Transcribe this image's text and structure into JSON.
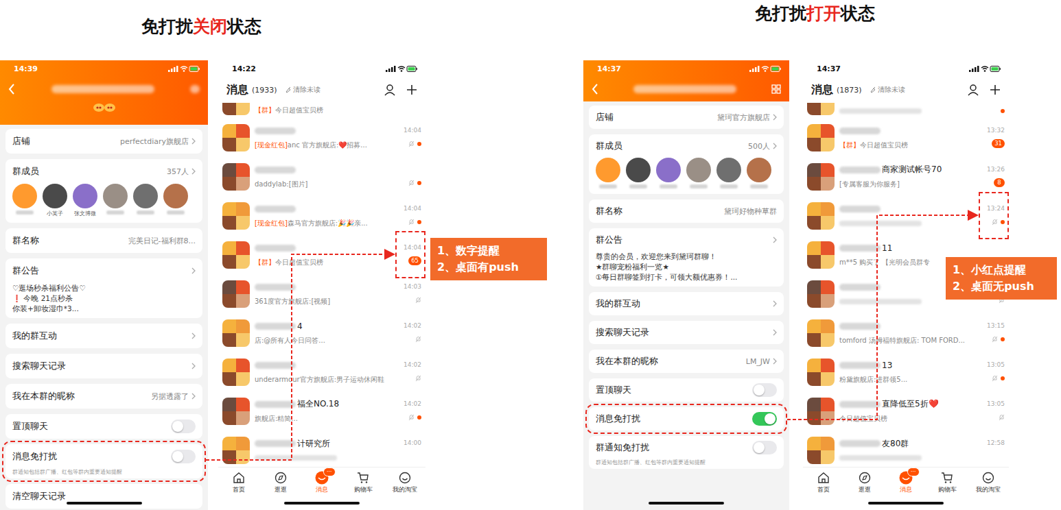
{
  "sections": [
    {
      "title": {
        "before": "免打扰",
        "state": "关闭",
        "after": "状态"
      },
      "settings": {
        "time": "14:39",
        "items": [
          {
            "kind": "link",
            "label": "店铺",
            "value": "perfectdiary旗舰店",
            "arrow": true
          },
          {
            "kind": "members",
            "label": "群成员",
            "value": "357人",
            "arrow": true,
            "members": [
              "",
              "小芙子",
              "张文博微",
              "",
              "",
              ""
            ]
          },
          {
            "kind": "link",
            "label": "群名称",
            "value": "完美日记-福利群8...",
            "arrow": false
          },
          {
            "kind": "notice",
            "label": "群公告",
            "arrow": true,
            "lines": [
              "♡逛场秒杀福利公告♡",
              "❗ 今晚 21点秒杀",
              "你装+卸妆湿巾*3..."
            ]
          },
          {
            "kind": "link",
            "label": "我的群互动",
            "value": "",
            "arrow": true
          },
          {
            "kind": "link",
            "label": "搜索聊天记录",
            "value": "",
            "arrow": true
          },
          {
            "kind": "link",
            "label": "我在本群的昵称",
            "value": "另据透露了",
            "arrow": true
          },
          {
            "kind": "toggle",
            "label": "置顶聊天",
            "on": false,
            "highlighted": false,
            "note": ""
          },
          {
            "kind": "toggle",
            "label": "消息免打扰",
            "on": false,
            "highlighted": true,
            "note": "群通知包括群广播、红包等群内重要通知提醒"
          },
          {
            "kind": "link",
            "label": "清空聊天记录",
            "value": "",
            "arrow": false
          }
        ]
      },
      "list": {
        "time": "14:22",
        "title": "消息",
        "count": "(1933)",
        "clear": "清除未读",
        "rows": [
          {
            "name": "",
            "tag": "【群】",
            "preview": "今日超值宝贝榜",
            "time": "",
            "badge": "",
            "muted": false,
            "dot": false,
            "highlighted": false
          },
          {
            "name": "",
            "tag": "[现金红包]",
            "preview": "anc 官方旗舰店:❤️招募...",
            "time": "14:04",
            "badge": "",
            "muted": true,
            "dot": true,
            "highlighted": false
          },
          {
            "name": "",
            "tag": "",
            "preview": "daddylab:[图片]",
            "time": "",
            "badge": "",
            "muted": true,
            "dot": true,
            "highlighted": false
          },
          {
            "name": "",
            "tag": "[现金红包]",
            "preview": "森马官方旗舰店:🎉🎉亲...",
            "time": "14:04",
            "badge": "",
            "muted": true,
            "dot": true,
            "highlighted": false
          },
          {
            "name": "",
            "tag": "【群】",
            "preview": "今日超值宝贝榜",
            "time": "14:04",
            "badge": "65",
            "muted": false,
            "dot": false,
            "highlighted": true
          },
          {
            "name": "",
            "tag": "",
            "preview": "361度官方旗舰店:[视频]",
            "time": "14:03",
            "badge": "",
            "muted": true,
            "dot": false,
            "highlighted": false
          },
          {
            "name": "4",
            "tag": "",
            "preview": "店:@所有人今日问答...",
            "time": "14:02",
            "badge": "",
            "muted": true,
            "dot": false,
            "highlighted": false
          },
          {
            "name": "",
            "tag": "",
            "preview": "underarmour官方旗舰店:男子运动休闲鞋",
            "time": "14:02",
            "badge": "",
            "muted": true,
            "dot": false,
            "highlighted": false
          },
          {
            "name": "福全NO.18",
            "tag": "",
            "preview": "旗舰店:精简...",
            "time": "14:02",
            "badge": "",
            "muted": true,
            "dot": true,
            "highlighted": false
          },
          {
            "name": "计研究所",
            "tag": "",
            "preview": "",
            "time": "14:00",
            "badge": "",
            "muted": false,
            "dot": false,
            "highlighted": false
          }
        ]
      },
      "tabs": [
        {
          "label": "首页",
          "selected": false,
          "badge": ""
        },
        {
          "label": "逛逛",
          "selected": false,
          "badge": ""
        },
        {
          "label": "消息",
          "selected": true,
          "badge": "···"
        },
        {
          "label": "购物车",
          "selected": false,
          "badge": ""
        },
        {
          "label": "我的淘宝",
          "selected": false,
          "badge": ""
        }
      ],
      "callout": [
        "1、数字提醒",
        "2、桌面有push"
      ]
    },
    {
      "title": {
        "before": "免打扰",
        "state": "打开",
        "after": "状态"
      },
      "settings": {
        "time": "14:37",
        "items": [
          {
            "kind": "link",
            "label": "店铺",
            "value": "黛珂官方旗舰店",
            "arrow": true
          },
          {
            "kind": "members",
            "label": "群成员",
            "value": "500人",
            "arrow": true,
            "members": [
              "",
              "",
              "",
              "",
              "",
              ""
            ]
          },
          {
            "kind": "link",
            "label": "群名称",
            "value": "黛珂好物种草群",
            "arrow": false
          },
          {
            "kind": "notice",
            "label": "群公告",
            "arrow": true,
            "lines": [
              "尊贵的会员，欢迎您来到黛珂群聊！",
              "★群聊宠粉福利一览★",
              "①每日群聊签到打卡，可领大额优惠券！..."
            ]
          },
          {
            "kind": "link",
            "label": "我的群互动",
            "value": "",
            "arrow": true
          },
          {
            "kind": "link",
            "label": "搜索聊天记录",
            "value": "",
            "arrow": true
          },
          {
            "kind": "link",
            "label": "我在本群的昵称",
            "value": "LM_JW",
            "arrow": true
          },
          {
            "kind": "toggle",
            "label": "置顶聊天",
            "on": false,
            "highlighted": false,
            "note": ""
          },
          {
            "kind": "toggle",
            "label": "消息免打扰",
            "on": true,
            "highlighted": true,
            "note": ""
          },
          {
            "kind": "toggle",
            "label": "群通知免打扰",
            "on": false,
            "highlighted": false,
            "note": "群通知包括群广播、红包等群内重要通知提醒"
          }
        ]
      },
      "list": {
        "time": "14:37",
        "title": "消息",
        "count": "(1873)",
        "clear": "清除未读",
        "rows": [
          {
            "name": "",
            "tag": "",
            "preview": "",
            "time": "",
            "badge": "",
            "muted": false,
            "dot": true,
            "highlighted": false
          },
          {
            "name": "",
            "tag": "【群】",
            "preview": "今日超值宝贝榜",
            "time": "13:32",
            "badge": "31",
            "muted": false,
            "dot": false,
            "highlighted": false
          },
          {
            "name": "商家测试帐号70",
            "tag": "",
            "preview": "[专属客服为你服务]",
            "time": "13:26",
            "badge": "8",
            "muted": false,
            "dot": false,
            "highlighted": false
          },
          {
            "name": "",
            "tag": "",
            "preview": "",
            "time": "13:24",
            "badge": "",
            "muted": true,
            "dot": true,
            "highlighted": true
          },
          {
            "name": "11",
            "tag": "",
            "preview": "m**5 购买了 【光明会员群专",
            "time": "",
            "badge": "",
            "muted": false,
            "dot": false,
            "highlighted": false
          },
          {
            "name": "",
            "tag": "",
            "preview": "",
            "time": "",
            "badge": "",
            "muted": true,
            "dot": false,
            "highlighted": false
          },
          {
            "name": "",
            "tag": "",
            "preview": "tomford 汤姆福特旗舰店: TOM FORD...",
            "time": "13:15",
            "badge": "",
            "muted": true,
            "dot": true,
            "highlighted": false
          },
          {
            "name": "13",
            "tag": "",
            "preview": "粉黛旗舰店:进群领5...",
            "time": "13:05",
            "badge": "",
            "muted": true,
            "dot": true,
            "highlighted": false
          },
          {
            "name": "直降低至5折❤️",
            "tag": "",
            "preview": "今日超值宝贝榜",
            "time": "13:05",
            "badge": "",
            "muted": true,
            "dot": false,
            "highlighted": false
          },
          {
            "name": "友80群",
            "tag": "",
            "preview": "",
            "time": "12:58",
            "badge": "",
            "muted": false,
            "dot": false,
            "highlighted": false
          }
        ]
      },
      "tabs": [
        {
          "label": "首页",
          "selected": false,
          "badge": ""
        },
        {
          "label": "逛逛",
          "selected": false,
          "badge": ""
        },
        {
          "label": "消息",
          "selected": true,
          "badge": "···"
        },
        {
          "label": "购物车",
          "selected": false,
          "badge": ""
        },
        {
          "label": "我的淘宝",
          "selected": false,
          "badge": ""
        }
      ],
      "callout": [
        "1、小红点提醒",
        "2、桌面无push"
      ]
    }
  ]
}
